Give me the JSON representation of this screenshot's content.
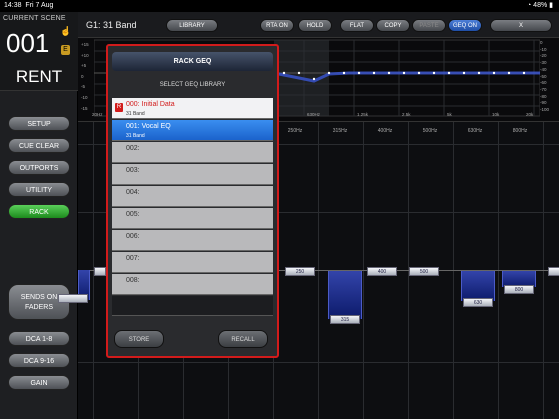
{
  "status": {
    "time": "14:38",
    "date": "Fri 7 Aug",
    "battery": "48%"
  },
  "scene": {
    "label": "CURRENT SCENE",
    "number": "001",
    "badge": "E",
    "name": "RENT"
  },
  "sidebar": {
    "setup": "SETUP",
    "cue_clear": "CUE CLEAR",
    "outports": "OUTPORTS",
    "utility": "UTILITY",
    "rack": "RACK",
    "sends_on_faders": "SENDS ON FADERS",
    "dca_1_8": "DCA 1-8",
    "dca_9_16": "DCA 9-16",
    "gain": "GAIN"
  },
  "topbar": {
    "title": "G1: 31 Band",
    "library": "LIBRARY",
    "rta_on": "RTA ON",
    "hold": "HOLD",
    "flat": "FLAT",
    "copy": "COPY",
    "paste": "PASTE",
    "geq_on": "GEQ ON",
    "close": "X"
  },
  "graph": {
    "left_scale": [
      "+15",
      "+10",
      "+5",
      "0",
      "-5",
      "-10",
      "-15"
    ],
    "right_scale": [
      "0",
      "-10",
      "-20",
      "-30",
      "-40",
      "-50",
      "-60",
      "-70",
      "-80",
      "-90",
      "-100"
    ],
    "freq_labels": [
      "20Hz",
      "630Hz",
      "1.25k",
      "2.5k",
      "5k",
      "10k",
      "20k"
    ]
  },
  "band_labels": [
    "250Hz",
    "315Hz",
    "400Hz",
    "500Hz",
    "630Hz",
    "800Hz"
  ],
  "faders": [
    "250",
    "315",
    "400",
    "500",
    "630",
    "800"
  ],
  "modal": {
    "title": "RACK GEQ",
    "subtitle": "SELECT GEQ LIBRARY",
    "items": [
      {
        "id": "000",
        "name": "000: Initial Data",
        "sub": "31 Band",
        "badge": "R"
      },
      {
        "id": "001",
        "name": "001: Vocal EQ",
        "sub": "31 Band"
      },
      {
        "id": "002",
        "name": "002:"
      },
      {
        "id": "003",
        "name": "003:"
      },
      {
        "id": "004",
        "name": "004:"
      },
      {
        "id": "005",
        "name": "005:"
      },
      {
        "id": "006",
        "name": "006:"
      },
      {
        "id": "007",
        "name": "007:"
      },
      {
        "id": "008",
        "name": "008:"
      }
    ],
    "store": "STORE",
    "recall": "RECALL"
  },
  "colors": {
    "accent_red": "#d21b1b",
    "select_blue": "#1b63cc",
    "rack_green": "#2aa32a"
  }
}
